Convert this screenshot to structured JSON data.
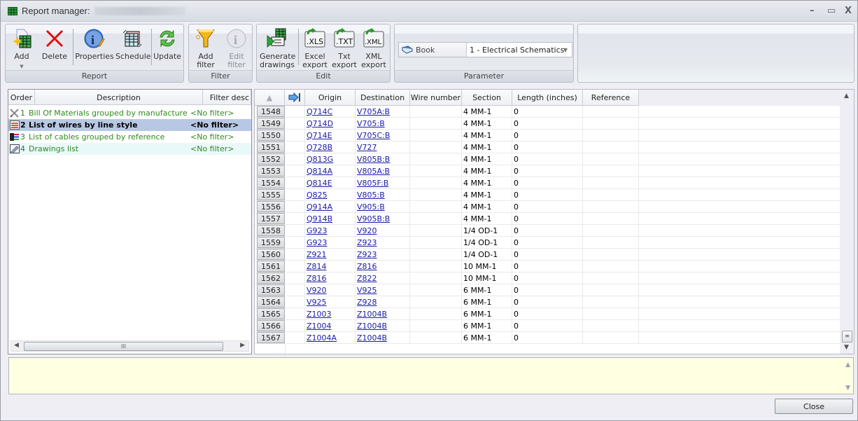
{
  "window": {
    "title": "Report manager:",
    "controls": {
      "minimize": "–",
      "maximize": "▭",
      "close": "X"
    }
  },
  "ribbon": {
    "groups": [
      {
        "label": "Report",
        "buttons": [
          {
            "label": "Add",
            "icon": "add-report-icon",
            "has_dropdown": true
          },
          {
            "label": "Delete",
            "icon": "delete-icon"
          },
          {
            "label": "Properties",
            "icon": "properties-icon"
          },
          {
            "label": "Schedule",
            "icon": "schedule-icon"
          },
          {
            "label": "Update",
            "icon": "update-icon"
          }
        ]
      },
      {
        "label": "Filter",
        "buttons": [
          {
            "label": "Add\nfilter",
            "line1": "Add",
            "line2": "filter",
            "icon": "add-filter-icon"
          },
          {
            "label": "Edit\nfilter",
            "line1": "Edit",
            "line2": "filter",
            "icon": "edit-filter-icon",
            "disabled": true
          }
        ]
      },
      {
        "label": "Edit",
        "buttons": [
          {
            "line1": "Generate",
            "line2": "drawings",
            "icon": "generate-drawings-icon"
          },
          {
            "line1": "Excel",
            "line2": "export",
            "icon": "xls-export-icon",
            "badge": ".XLS"
          },
          {
            "line1": "Txt",
            "line2": "export",
            "icon": "txt-export-icon",
            "badge": ".TXT"
          },
          {
            "line1": "XML",
            "line2": "export",
            "icon": "xml-export-icon",
            "badge": ".XML"
          }
        ]
      },
      {
        "label": "Parameter",
        "param": {
          "label": "Book",
          "value": "1 - Electrical Schematics"
        }
      }
    ]
  },
  "reports": {
    "columns": [
      "Order",
      "Description",
      "Filter desc"
    ],
    "rows": [
      {
        "order": "1",
        "description": "Bill Of Materials grouped by manufacturer",
        "filter": "<No filter>",
        "icon": "bom-tools-icon"
      },
      {
        "order": "2",
        "description": "List of wires by line style",
        "filter": "<No filter>",
        "icon": "wires-list-icon",
        "selected": true
      },
      {
        "order": "3",
        "description": "List of cables grouped by reference",
        "filter": "<No filter>",
        "icon": "cables-icon"
      },
      {
        "order": "4",
        "description": "Drawings list",
        "filter": "<No filter>",
        "icon": "drawings-icon"
      }
    ],
    "hscroll_thumb": "III"
  },
  "wires": {
    "columns": [
      "▲",
      "",
      "Origin",
      "Destination",
      "Wire number",
      "Section",
      "Length (inches)",
      "Reference"
    ],
    "rows": [
      {
        "num": "1548",
        "origin": "Q714C",
        "destination": "V705A:B",
        "wire": "",
        "section": "4 MM-1",
        "length": "0",
        "reference": ""
      },
      {
        "num": "1549",
        "origin": "Q714D",
        "destination": "V705:B",
        "wire": "",
        "section": "4 MM-1",
        "length": "0",
        "reference": ""
      },
      {
        "num": "1550",
        "origin": "Q714E",
        "destination": "V705C:B",
        "wire": "",
        "section": "4 MM-1",
        "length": "0",
        "reference": ""
      },
      {
        "num": "1551",
        "origin": "Q728B",
        "destination": "V727",
        "wire": "",
        "section": "4 MM-1",
        "length": "0",
        "reference": ""
      },
      {
        "num": "1552",
        "origin": "Q813G",
        "destination": "V805B:B",
        "wire": "",
        "section": "4 MM-1",
        "length": "0",
        "reference": ""
      },
      {
        "num": "1553",
        "origin": "Q814A",
        "destination": "V805A:B",
        "wire": "",
        "section": "4 MM-1",
        "length": "0",
        "reference": ""
      },
      {
        "num": "1554",
        "origin": "Q814E",
        "destination": "V805F:B",
        "wire": "",
        "section": "4 MM-1",
        "length": "0",
        "reference": ""
      },
      {
        "num": "1555",
        "origin": "Q825",
        "destination": "V805:B",
        "wire": "",
        "section": "4 MM-1",
        "length": "0",
        "reference": ""
      },
      {
        "num": "1556",
        "origin": "Q914A",
        "destination": "V905:B",
        "wire": "",
        "section": "4 MM-1",
        "length": "0",
        "reference": ""
      },
      {
        "num": "1557",
        "origin": "Q914B",
        "destination": "V905B:B",
        "wire": "",
        "section": "4 MM-1",
        "length": "0",
        "reference": ""
      },
      {
        "num": "1558",
        "origin": "G923",
        "destination": "V920",
        "wire": "",
        "section": "1/4 OD-1",
        "length": "0",
        "reference": ""
      },
      {
        "num": "1559",
        "origin": "G923",
        "destination": "Z923",
        "wire": "",
        "section": "1/4 OD-1",
        "length": "0",
        "reference": ""
      },
      {
        "num": "1560",
        "origin": "Z921",
        "destination": "Z923",
        "wire": "",
        "section": "1/4 OD-1",
        "length": "0",
        "reference": ""
      },
      {
        "num": "1561",
        "origin": "Z814",
        "destination": "Z816",
        "wire": "",
        "section": "10 MM-1",
        "length": "0",
        "reference": ""
      },
      {
        "num": "1562",
        "origin": "Z816",
        "destination": "Z822",
        "wire": "",
        "section": "10 MM-1",
        "length": "0",
        "reference": ""
      },
      {
        "num": "1563",
        "origin": "V920",
        "destination": "V925",
        "wire": "",
        "section": "6 MM-1",
        "length": "0",
        "reference": ""
      },
      {
        "num": "1564",
        "origin": "V925",
        "destination": "Z928",
        "wire": "",
        "section": "6 MM-1",
        "length": "0",
        "reference": ""
      },
      {
        "num": "1565",
        "origin": "Z1003",
        "destination": "Z1004B",
        "wire": "",
        "section": "6 MM-1",
        "length": "0",
        "reference": ""
      },
      {
        "num": "1566",
        "origin": "Z1004",
        "destination": "Z1004B",
        "wire": "",
        "section": "6 MM-1",
        "length": "0",
        "reference": ""
      },
      {
        "num": "1567",
        "origin": "Z1004A",
        "destination": "Z1004B",
        "wire": "",
        "section": "6 MM-1",
        "length": "0",
        "reference": ""
      }
    ]
  },
  "message": {
    "text": ""
  },
  "footer": {
    "close_label": "Close"
  },
  "colors": {
    "selected_row": "#b8c8e4",
    "link": "#1a1aa6",
    "report_text": "#2f8a1e",
    "message_bg": "#ffffe1"
  }
}
